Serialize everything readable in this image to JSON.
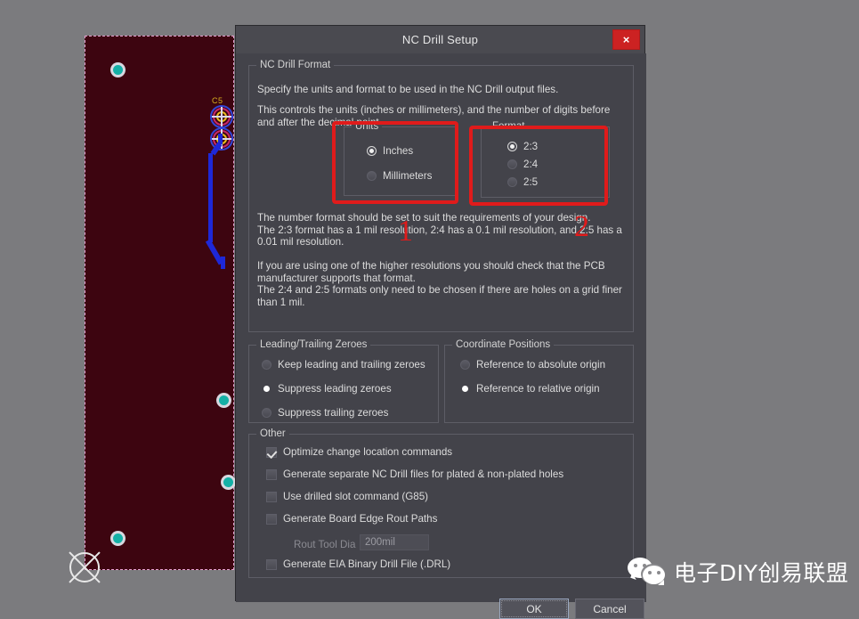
{
  "dialog": {
    "title": "NC Drill Setup",
    "close_label": "×",
    "format_group": {
      "legend": "NC Drill Format",
      "para1": "Specify the units and format to be used in the NC Drill output files.",
      "para2": "This controls the units (inches or millimeters), and the number of digits before and after the decimal point.",
      "para3": "The number format should be set to suit the requirements of your design.\nThe 2:3 format has a 1 mil resolution, 2:4 has a 0.1 mil resolution, and 2:5 has a\n0.01 mil resolution.",
      "para4": "If you are using one of the higher resolutions you should check that the PCB\nmanufacturer supports that format.\nThe 2:4 and 2:5 formats only need to be chosen if there are holes on a grid finer\nthan 1 mil.",
      "units": {
        "legend": "Units",
        "options": [
          {
            "label": "Inches",
            "checked": true
          },
          {
            "label": "Millimeters",
            "checked": false
          }
        ]
      },
      "format": {
        "legend": "Format",
        "options": [
          {
            "label": "2:3",
            "checked": true
          },
          {
            "label": "2:4",
            "checked": false
          },
          {
            "label": "2:5",
            "checked": false
          }
        ]
      }
    },
    "zeroes_group": {
      "legend": "Leading/Trailing Zeroes",
      "options": [
        {
          "label": "Keep leading and trailing zeroes",
          "checked": false
        },
        {
          "label": "Suppress leading zeroes",
          "checked": true
        },
        {
          "label": "Suppress trailing zeroes",
          "checked": false
        }
      ]
    },
    "coordinates_group": {
      "legend": "Coordinate Positions",
      "options": [
        {
          "label": "Reference to absolute origin",
          "checked": false
        },
        {
          "label": "Reference to relative origin",
          "checked": true
        }
      ]
    },
    "other_group": {
      "legend": "Other",
      "options": [
        {
          "label": "Optimize change location commands",
          "checked": true
        },
        {
          "label": "Generate separate NC Drill files for plated & non-plated holes",
          "checked": false
        },
        {
          "label": "Use drilled slot command (G85)",
          "checked": false
        },
        {
          "label": "Generate Board Edge Rout Paths",
          "checked": false
        },
        {
          "label": "Generate EIA Binary Drill File (.DRL)",
          "checked": false
        }
      ],
      "rout_tool_dia_label": "Rout Tool Dia",
      "rout_tool_dia_value": "200mil"
    },
    "buttons": {
      "ok": "OK",
      "cancel": "Cancel"
    }
  },
  "annotations": [
    {
      "number": "1",
      "target": "units-group"
    },
    {
      "number": "2",
      "target": "format-group"
    }
  ],
  "pcb": {
    "component_label": "C5"
  },
  "watermark": {
    "text": "电子DIY创易联盟"
  },
  "colors": {
    "accent_red": "#e01b1b",
    "dialog_bg": "#43434a",
    "titlebar_bg": "#4a4a50",
    "close_bg": "#cc2222",
    "board": "#3d0510",
    "board_outline": "#e8a0d0",
    "via": "#14b0a6",
    "trace": "#1e28d8",
    "pad_label": "#d8b020"
  }
}
